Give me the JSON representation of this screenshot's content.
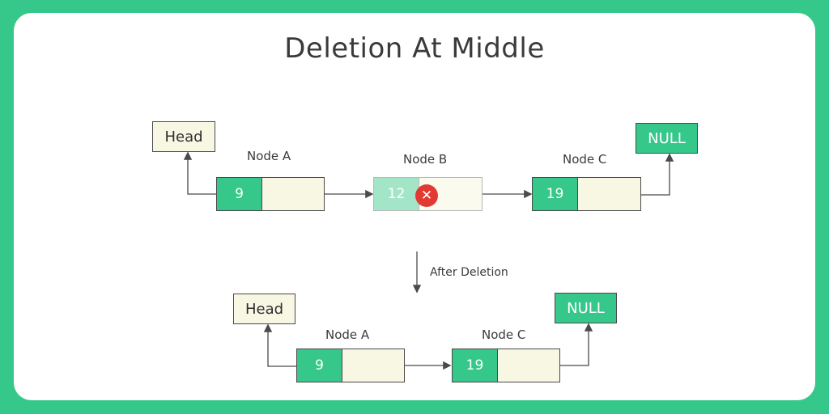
{
  "title": "Deletion At Middle",
  "before": {
    "head_label": "Head",
    "null_label": "NULL",
    "nodes": [
      {
        "name": "Node A",
        "value": "9",
        "status": "kept"
      },
      {
        "name": "Node B",
        "value": "12",
        "status": "deleted"
      },
      {
        "name": "Node C",
        "value": "19",
        "status": "kept"
      }
    ],
    "deleted_icon": "close-x-icon"
  },
  "transition_label": "After Deletion",
  "after": {
    "head_label": "Head",
    "null_label": "NULL",
    "nodes": [
      {
        "name": "Node A",
        "value": "9"
      },
      {
        "name": "Node C",
        "value": "19"
      }
    ]
  },
  "colors": {
    "background": "#36c88a",
    "node_data": "#36c88a",
    "node_next": "#f8f7e4",
    "deleted_data": "#a3e6c7",
    "delete_marker": "#e03a32"
  }
}
